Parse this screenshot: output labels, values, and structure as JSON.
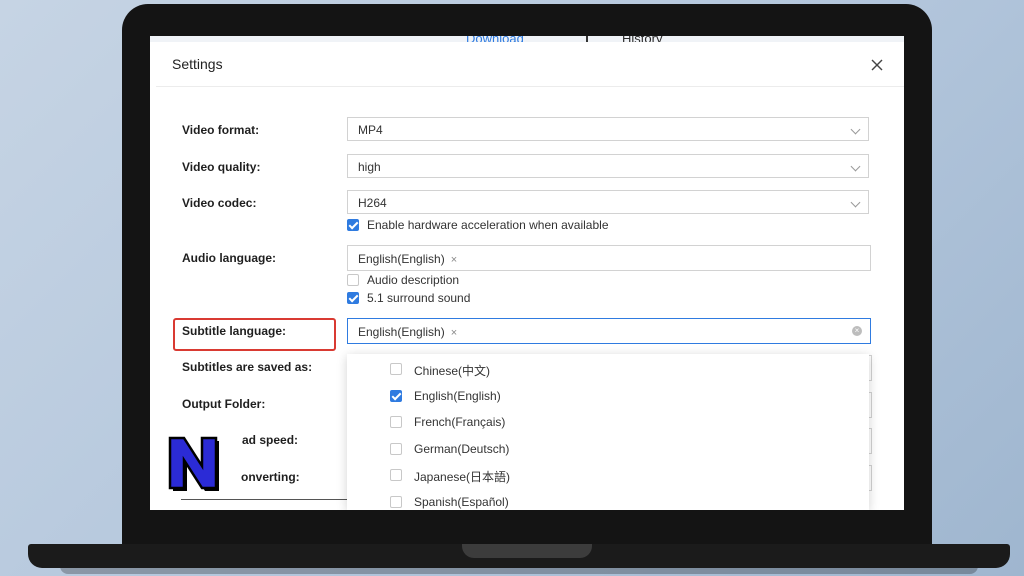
{
  "app": {
    "tabs": {
      "download": "Download",
      "history": "History"
    }
  },
  "dialog": {
    "title": "Settings",
    "labels": {
      "video_format": "Video format:",
      "video_quality": "Video quality:",
      "video_codec": "Video codec:",
      "audio_language": "Audio language:",
      "subtitle_language": "Subtitle language:",
      "subtitles_saved_as": "Subtitles are saved as:",
      "output_folder": "Output Folder:",
      "download_speed_partial": "ad speed:",
      "after_converting_partial": "onverting:"
    },
    "video_format": {
      "value": "MP4"
    },
    "video_quality": {
      "value": "high"
    },
    "video_codec": {
      "value": "H264"
    },
    "hardware_acceleration": {
      "label": "Enable hardware acceleration when available",
      "checked": true
    },
    "audio_language": {
      "tag": "English(English)",
      "tag_remove": "×"
    },
    "audio_description": {
      "label": "Audio description",
      "checked": false
    },
    "surround_sound": {
      "label": "5.1 surround sound",
      "checked": true
    },
    "subtitle_language": {
      "tag": "English(English)",
      "tag_remove": "×",
      "clear": "×"
    },
    "subtitle_options": [
      {
        "label": "Chinese(中文)",
        "checked": false
      },
      {
        "label": "English(English)",
        "checked": true
      },
      {
        "label": "French(Français)",
        "checked": false
      },
      {
        "label": "German(Deutsch)",
        "checked": false
      },
      {
        "label": "Japanese(日本語)",
        "checked": false
      },
      {
        "label": "Spanish(Español)",
        "checked": false
      }
    ]
  },
  "colors": {
    "accent": "#2f7be0",
    "highlight": "#d93a32",
    "logo_fill": "#2b2bd6"
  },
  "icons": {
    "close": "close-icon",
    "chevron": "chevron-down-icon",
    "checkbox": "checkbox-icon",
    "logo": "n-logo-icon"
  }
}
